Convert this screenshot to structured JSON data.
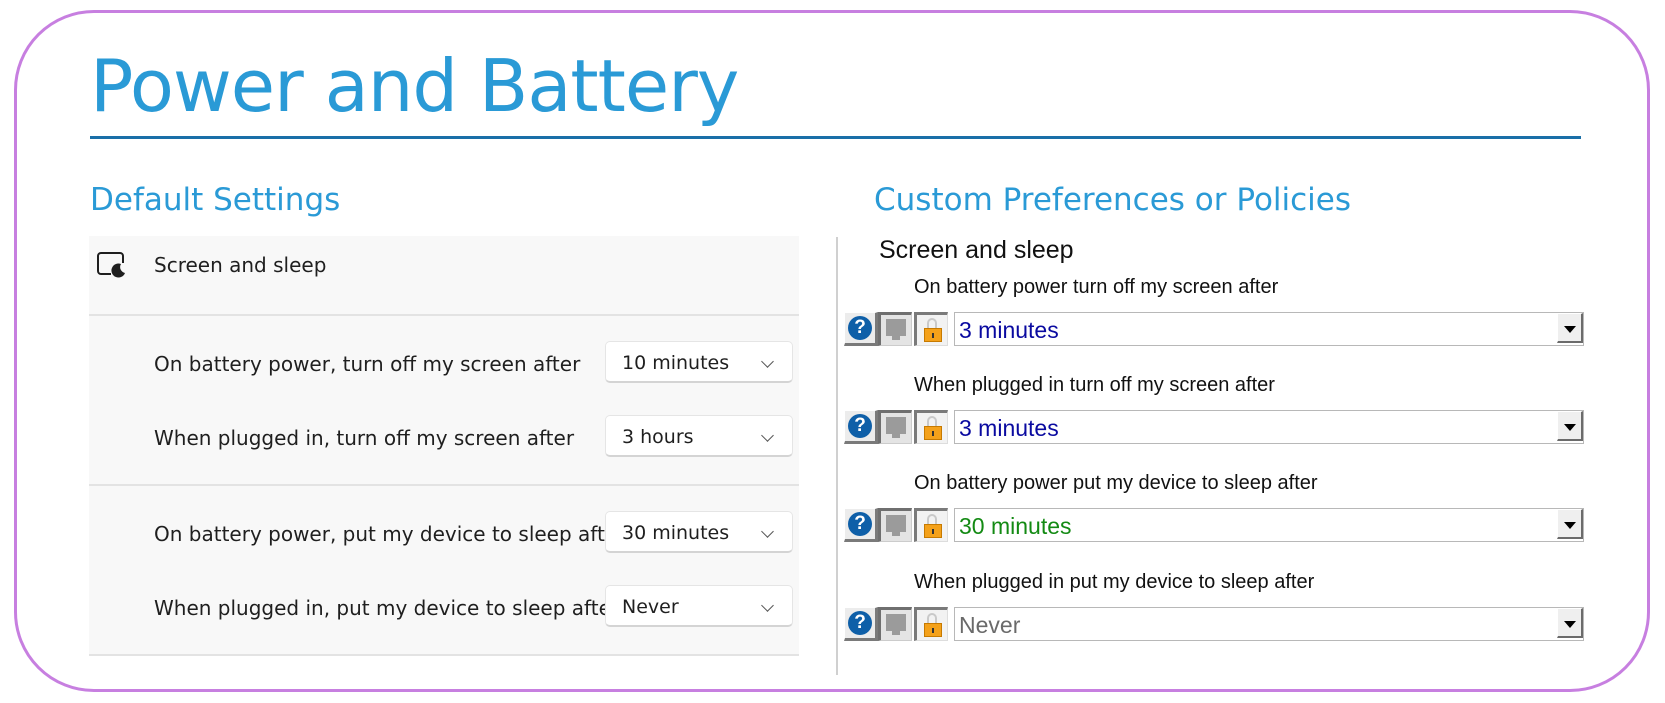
{
  "page": {
    "title": "Power and Battery",
    "colors": {
      "accent": "#2a9ad6",
      "rule": "#1a6fa8",
      "frame": "#c77fe0"
    }
  },
  "default_settings": {
    "heading": "Default Settings",
    "group_title": "Screen and sleep",
    "group_icon": "screen-sleep-icon",
    "rows": [
      {
        "label": "On battery power, turn off my screen after",
        "value": "10 minutes"
      },
      {
        "label": "When plugged in, turn off my screen after",
        "value": "3 hours"
      },
      {
        "label": "On battery power, put my device to sleep after",
        "value": "30 minutes"
      },
      {
        "label": "When plugged in, put my device to sleep after",
        "value": "Never"
      }
    ]
  },
  "custom": {
    "heading": "Custom Preferences or Policies",
    "group_title": "Screen and sleep",
    "items": [
      {
        "label": "On battery power turn off my screen after",
        "value": "3 minutes",
        "value_color": "#0a0aa0"
      },
      {
        "label": "When plugged in turn off my screen after",
        "value": "3 minutes",
        "value_color": "#0a0aa0"
      },
      {
        "label": "On battery power put my device to sleep after",
        "value": "30 minutes",
        "value_color": "#138a13"
      },
      {
        "label": "When plugged in put my device to sleep after",
        "value": "Never",
        "value_color": "#6a6a6a"
      }
    ],
    "icons": {
      "help": "?",
      "help_icon": "help-icon",
      "monitor_icon": "monitor-icon",
      "lock_icon": "lock-icon"
    }
  }
}
